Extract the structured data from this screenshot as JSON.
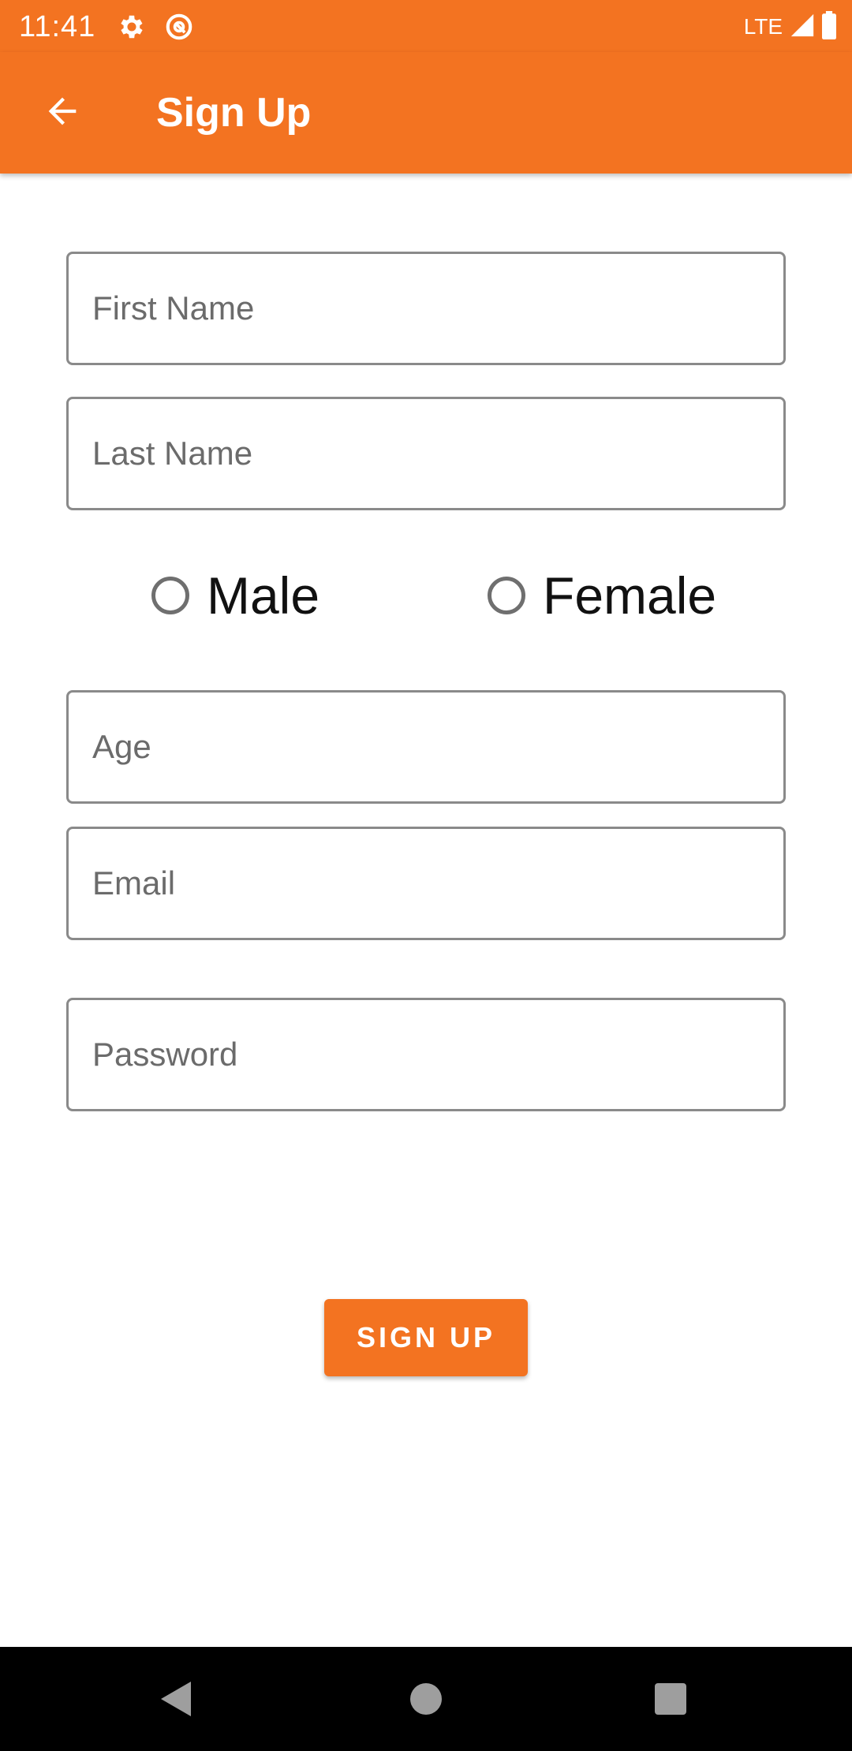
{
  "status_bar": {
    "time": "11:41",
    "network": "LTE",
    "icons": [
      "settings-gear-icon",
      "at-sign-icon",
      "signal-icon",
      "battery-icon"
    ]
  },
  "app_bar": {
    "title": "Sign Up",
    "back_icon": "arrow-back-icon"
  },
  "form": {
    "first_name": {
      "placeholder": "First Name",
      "value": ""
    },
    "last_name": {
      "placeholder": "Last Name",
      "value": ""
    },
    "gender": {
      "options": [
        {
          "label": "Male",
          "selected": false
        },
        {
          "label": "Female",
          "selected": false
        }
      ]
    },
    "age": {
      "placeholder": "Age",
      "value": ""
    },
    "email": {
      "placeholder": "Email",
      "value": ""
    },
    "password": {
      "placeholder": "Password",
      "value": ""
    },
    "submit_label": "SIGN UP"
  },
  "nav_bar": {
    "icons": [
      "back-triangle-icon",
      "home-circle-icon",
      "recents-square-icon"
    ]
  },
  "colors": {
    "primary": "#f37321",
    "field_border": "#8a8a8a",
    "radio_border": "#6f6f6f",
    "nav_background": "#000000"
  }
}
